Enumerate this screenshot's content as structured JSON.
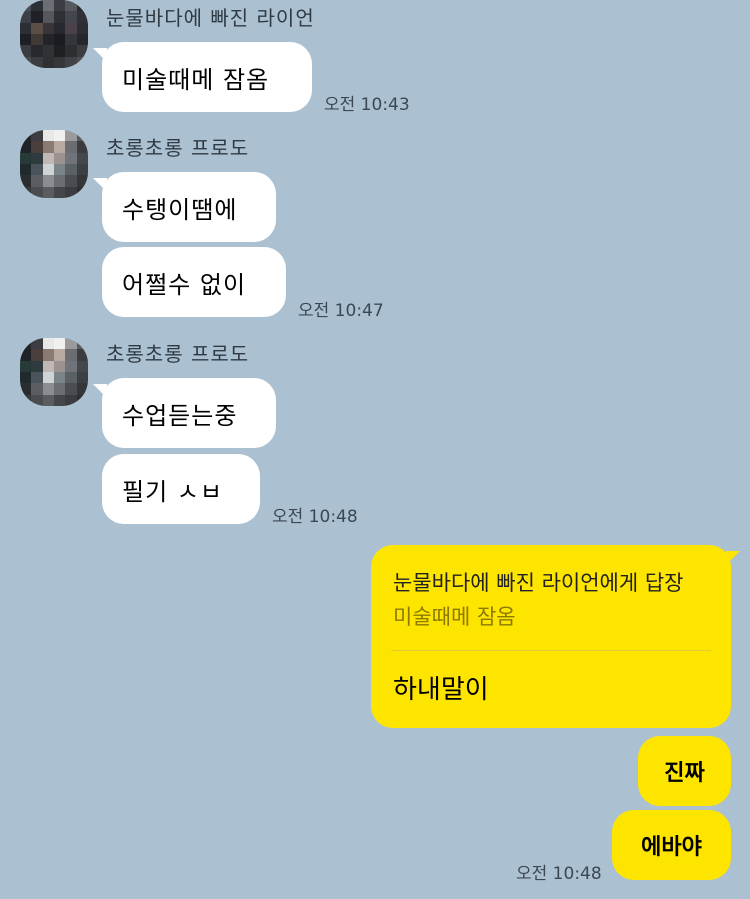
{
  "chat": {
    "messages": [
      {
        "sender": "눈물바다에 빠진 라이언",
        "lines": [
          "미술때메 잠옴"
        ],
        "time": "오전 10:43"
      },
      {
        "sender": "초롱초롱 프로도",
        "lines": [
          "수탱이땜에",
          "어쩔수 없이"
        ],
        "time": "오전 10:47"
      },
      {
        "sender": "초롱초롱 프로도",
        "lines": [
          "수업듣는중",
          "필기 ㅅㅂ"
        ],
        "time": "오전 10:48"
      }
    ],
    "my_reply": {
      "header": "눈물바다에 빠진 라이언에게 답장",
      "quote": "미술때메 잠옴",
      "text": "하내말이"
    },
    "my_messages": [
      "진짜",
      "에바야"
    ],
    "my_time": "오전 10:48"
  },
  "colors": {
    "background": "#abc1d1",
    "my_bubble": "#fee500",
    "other_bubble": "#ffffff"
  }
}
